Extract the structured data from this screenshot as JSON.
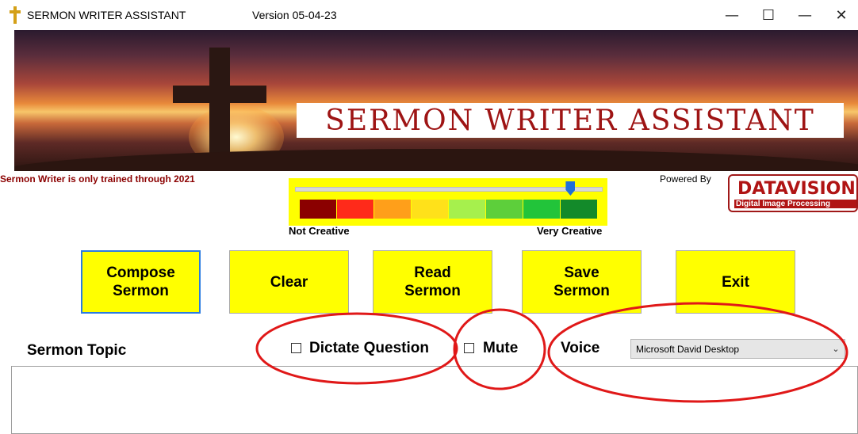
{
  "window": {
    "title": "SERMON WRITER ASSISTANT",
    "version": "Version 05-04-23",
    "controls": {
      "minimize": "—",
      "maximize": "☐",
      "close": "✕"
    }
  },
  "banner": {
    "title": "SERMON WRITER ASSISTANT"
  },
  "notes": {
    "trained": "Sermon Writer is only trained through 2021",
    "powered_by": "Powered By"
  },
  "logo": {
    "word": "DATAVISION",
    "subtitle": "Digital Image Processing"
  },
  "creativity": {
    "low_label": "Not Creative",
    "high_label": "Very Creative",
    "level": 0.9,
    "scale_colors": [
      "#8b0000",
      "#ff2a1a",
      "#ff9f1a",
      "#ffe11a",
      "#a6f04d",
      "#5dcf3b",
      "#22c43a",
      "#138a2a"
    ]
  },
  "buttons": {
    "compose": "Compose Sermon",
    "clear": "Clear",
    "read": "Read Sermon",
    "save": "Save Sermon",
    "exit": "Exit"
  },
  "options": {
    "topic_label": "Sermon Topic",
    "dictate_label": "Dictate Question",
    "dictate_checked": false,
    "mute_label": "Mute",
    "mute_checked": false,
    "voice_label": "Voice",
    "voice_selected": "Microsoft David Desktop"
  },
  "topic_text": "",
  "colors": {
    "button_bg": "#ffff00",
    "accent_red": "#9e1414",
    "annotation_red": "#e01818"
  }
}
